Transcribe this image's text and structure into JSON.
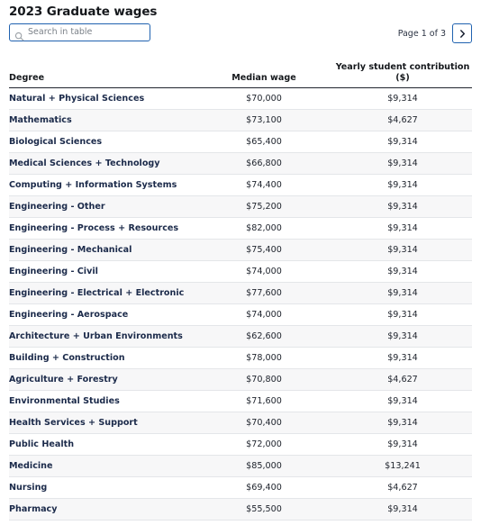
{
  "title": "2023 Graduate wages",
  "search": {
    "placeholder": "Search in table",
    "value": "",
    "icon": "search-icon"
  },
  "pagination": {
    "label": "Page 1 of 3",
    "next_icon": "chevron-right-icon",
    "current_page": 1,
    "total_pages": 3
  },
  "colors": {
    "accent_border": "#2062b0",
    "degree_text": "#1b2a4a",
    "value_text": "#20252e",
    "row_stripe": "#f7f7f8",
    "header_rule": "#20252e"
  },
  "table": {
    "columns": [
      "Degree",
      "Median wage",
      "Yearly student contribution ($)"
    ],
    "column_header_lines": {
      "degree": "Degree",
      "median_wage": "Median wage",
      "contribution_line1": "Yearly student contribution",
      "contribution_line2": "($)"
    },
    "rows": [
      {
        "degree": "Natural + Physical Sciences",
        "median_wage": "$70,000",
        "contribution": "$9,314"
      },
      {
        "degree": "Mathematics",
        "median_wage": "$73,100",
        "contribution": "$4,627"
      },
      {
        "degree": "Biological Sciences",
        "median_wage": "$65,400",
        "contribution": "$9,314"
      },
      {
        "degree": "Medical Sciences + Technology",
        "median_wage": "$66,800",
        "contribution": "$9,314"
      },
      {
        "degree": "Computing + Information Systems",
        "median_wage": "$74,400",
        "contribution": "$9,314"
      },
      {
        "degree": "Engineering - Other",
        "median_wage": "$75,200",
        "contribution": "$9,314"
      },
      {
        "degree": "Engineering - Process + Resources",
        "median_wage": "$82,000",
        "contribution": "$9,314"
      },
      {
        "degree": "Engineering - Mechanical",
        "median_wage": "$75,400",
        "contribution": "$9,314"
      },
      {
        "degree": "Engineering - Civil",
        "median_wage": "$74,000",
        "contribution": "$9,314"
      },
      {
        "degree": "Engineering - Electrical + Electronic",
        "median_wage": "$77,600",
        "contribution": "$9,314"
      },
      {
        "degree": "Engineering - Aerospace",
        "median_wage": "$74,000",
        "contribution": "$9,314"
      },
      {
        "degree": "Architecture + Urban Environments",
        "median_wage": "$62,600",
        "contribution": "$9,314"
      },
      {
        "degree": "Building + Construction",
        "median_wage": "$78,000",
        "contribution": "$9,314"
      },
      {
        "degree": "Agriculture + Forestry",
        "median_wage": "$70,800",
        "contribution": "$4,627"
      },
      {
        "degree": "Environmental Studies",
        "median_wage": "$71,600",
        "contribution": "$9,314"
      },
      {
        "degree": "Health Services + Support",
        "median_wage": "$70,400",
        "contribution": "$9,314"
      },
      {
        "degree": "Public Health",
        "median_wage": "$72,000",
        "contribution": "$9,314"
      },
      {
        "degree": "Medicine",
        "median_wage": "$85,000",
        "contribution": "$13,241"
      },
      {
        "degree": "Nursing",
        "median_wage": "$69,400",
        "contribution": "$4,627"
      },
      {
        "degree": "Pharmacy",
        "median_wage": "$55,500",
        "contribution": "$9,314"
      }
    ]
  }
}
